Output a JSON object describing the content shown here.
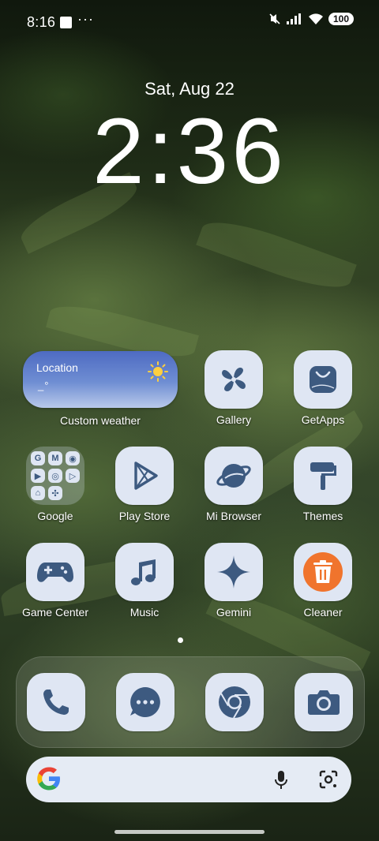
{
  "status_bar": {
    "time": "8:16",
    "overflow": "···",
    "battery": "100"
  },
  "lock": {
    "date": "Sat, Aug 22",
    "time": "2:36"
  },
  "weather_widget": {
    "location": "Location",
    "temperature": "_°",
    "label": "Custom weather",
    "icon": "sun-icon"
  },
  "apps": [
    {
      "label": "Gallery",
      "icon": "pinwheel-icon"
    },
    {
      "label": "GetApps",
      "icon": "shopping-bag-icon"
    },
    {
      "label": "Google",
      "icon": "folder-icon"
    },
    {
      "label": "Play Store",
      "icon": "play-icon"
    },
    {
      "label": "Mi Browser",
      "icon": "planet-icon"
    },
    {
      "label": "Themes",
      "icon": "paint-roller-icon"
    },
    {
      "label": "Game Center",
      "icon": "gamepad-icon"
    },
    {
      "label": "Music",
      "icon": "music-note-icon"
    },
    {
      "label": "Gemini",
      "icon": "sparkle-icon"
    },
    {
      "label": "Cleaner",
      "icon": "trash-icon"
    }
  ],
  "google_folder": {
    "letters": [
      "G",
      "M",
      "◉",
      "▶",
      "◎",
      "▷",
      "⌂",
      "✣",
      ""
    ]
  },
  "dock": [
    {
      "name": "Phone",
      "icon": "phone-icon"
    },
    {
      "name": "Messages",
      "icon": "chat-icon"
    },
    {
      "name": "Chrome",
      "icon": "chrome-icon"
    },
    {
      "name": "Camera",
      "icon": "camera-icon"
    }
  ],
  "search_bar": {
    "logo": "G",
    "mic": "mic-icon",
    "lens": "lens-icon"
  },
  "colors": {
    "tile": "#dfe6f3",
    "icon": "#3d5a80",
    "cleaner": "#f0742d",
    "weather_top": "#4e6bc2"
  }
}
